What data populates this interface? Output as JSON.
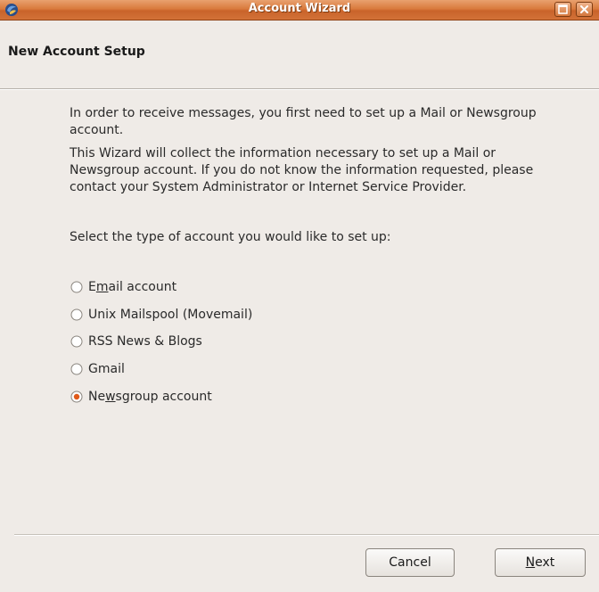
{
  "window": {
    "title": "Account Wizard",
    "app_icon": "thunderbird-icon",
    "controls": [
      "maximize-icon",
      "close-icon"
    ]
  },
  "header": {
    "title": "New Account Setup"
  },
  "content": {
    "para1": "In order to receive messages, you first need to set up a Mail or Newsgroup account.",
    "para2": "This Wizard will collect the information necessary to set up a Mail or Newsgroup account. If you do not know the information requested, please contact your System Administrator or Internet Service Provider.",
    "para3": "Select the type of account you would like to set up:"
  },
  "account_types": [
    {
      "label": "Email account",
      "mnemonic": "m",
      "before": "E",
      "after": "ail account",
      "selected": false
    },
    {
      "label": "Unix Mailspool (Movemail)",
      "selected": false
    },
    {
      "label": "RSS News & Blogs",
      "selected": false
    },
    {
      "label": "Gmail",
      "selected": false
    },
    {
      "label": "Newsgroup account",
      "mnemonic": "w",
      "before": "Ne",
      "after": "sgroup account",
      "selected": true
    }
  ],
  "buttons": {
    "cancel": "Cancel",
    "next_mnemonic": "N",
    "next_rest": "ext"
  },
  "colors": {
    "titlebar": "#d97a3d",
    "radio_selected": "#e05a1a",
    "background": "#efebe7"
  }
}
